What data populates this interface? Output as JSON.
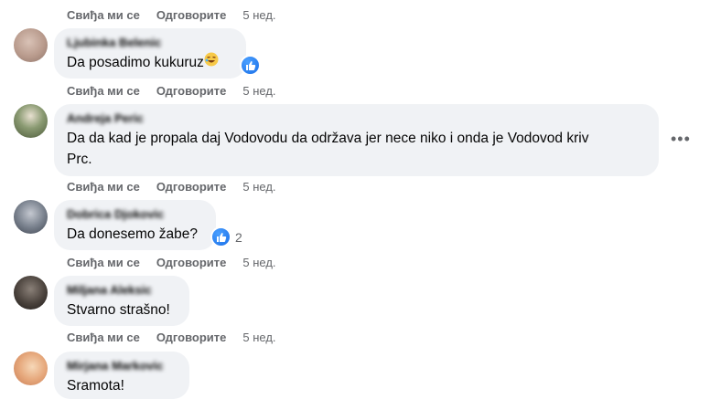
{
  "actions": {
    "like": "Свиђа ми се",
    "reply": "Одговорите",
    "time": "5 нед."
  },
  "comments": [
    {
      "author": "Ljubinka Belenic",
      "text": "Da posadimo kukuruz"
    },
    {
      "author": "Andreja Peric",
      "text_line1": "Da da kad je propala daj Vodovodu da održava jer nece niko i onda je Vodovod kriv",
      "text_line2": "Prc."
    },
    {
      "author": "Dobrica Djokovic",
      "text": "Da donesemo žabe?",
      "reaction_count": "2"
    },
    {
      "author": "Miljana Aleksic",
      "text": "Stvarno strašno!"
    },
    {
      "author": "Mirjana Markovic",
      "text": "Sramota!"
    }
  ],
  "colors": {
    "bubble": "#f0f2f5",
    "secondary_text": "#65676b",
    "like_blue": "#1a6fe8"
  },
  "icons": {
    "like": "thumbs-up-icon",
    "laugh": "laughing-emoji-icon",
    "more": "more-options-icon"
  }
}
